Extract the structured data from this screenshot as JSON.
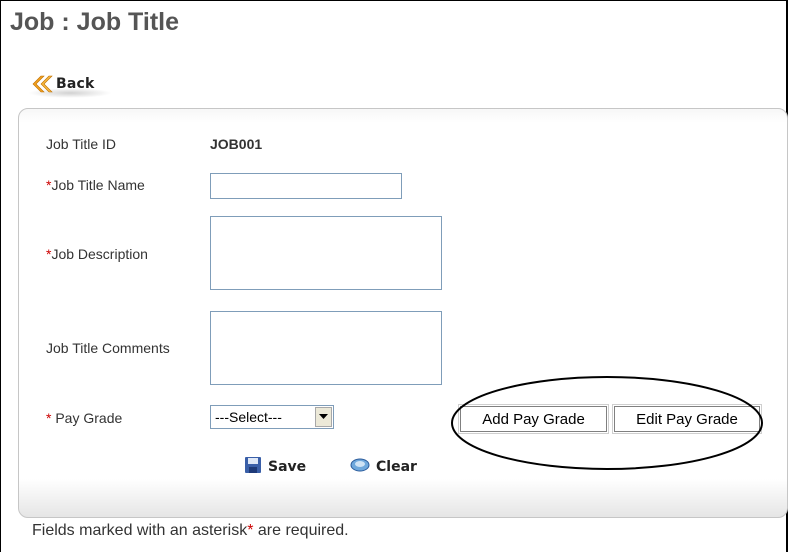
{
  "page": {
    "title": "Job : Job Title"
  },
  "toolbar": {
    "back_label": "Back",
    "back_icon": "double-chevron-left-icon"
  },
  "form": {
    "job_title_id_label": "Job Title ID",
    "job_title_id_value": "JOB001",
    "job_title_name_label": "Job Title Name",
    "job_title_name_value": "",
    "job_description_label": "Job Description",
    "job_description_value": "",
    "job_title_comments_label": "Job Title Comments",
    "job_title_comments_value": "",
    "pay_grade_label": "Pay Grade",
    "pay_grade_selected": "---Select---",
    "required_mark": "*",
    "add_pay_grade_label": "Add Pay Grade",
    "edit_pay_grade_label": "Edit Pay Grade",
    "save_label": "Save",
    "clear_label": "Clear"
  },
  "footer": {
    "note_before": "Fields marked with an asterisk",
    "note_mark": "*",
    "note_after": "are required."
  },
  "colors": {
    "required": "#cc0000",
    "title": "#555555",
    "accent_orange": "#f0a020"
  }
}
